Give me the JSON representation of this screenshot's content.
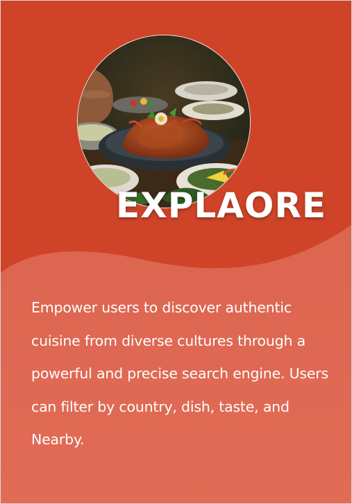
{
  "card": {
    "title": "EXPLAORE",
    "description": "Empower users to discover authentic cuisine from diverse cultures through a powerful and precise search engine. Users can filter by country, dish, taste, and Nearby.",
    "image_icon": "food-photo-icon",
    "colors": {
      "background": "#cf4428",
      "wave": "#df6a55",
      "text": "#ffffff"
    }
  }
}
